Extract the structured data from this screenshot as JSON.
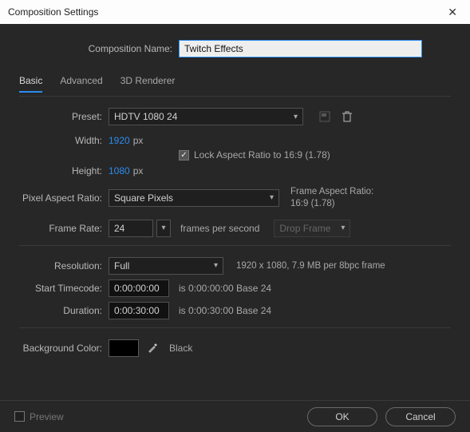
{
  "title": "Composition Settings",
  "header": {
    "comp_name_label": "Composition Name:",
    "comp_name_value": "Twitch Effects"
  },
  "tabs": {
    "basic": "Basic",
    "advanced": "Advanced",
    "renderer": "3D Renderer"
  },
  "preset": {
    "label": "Preset:",
    "value": "HDTV 1080 24"
  },
  "dimensions": {
    "width_label": "Width:",
    "width_value": "1920",
    "height_label": "Height:",
    "height_value": "1080",
    "px_unit": "px",
    "lock_label": "Lock Aspect Ratio to 16:9 (1.78)"
  },
  "par": {
    "label": "Pixel Aspect Ratio:",
    "value": "Square Pixels",
    "frame_aspect_label": "Frame Aspect Ratio:",
    "frame_aspect_value": "16:9 (1.78)"
  },
  "frame_rate": {
    "label": "Frame Rate:",
    "value": "24",
    "unit": "frames per second",
    "drop": "Drop Frame"
  },
  "resolution": {
    "label": "Resolution:",
    "value": "Full",
    "info": "1920 x 1080, 7.9 MB per 8bpc frame"
  },
  "timecode": {
    "start_label": "Start Timecode:",
    "start_value": "0:00:00:00",
    "start_info": "is 0:00:00:00  Base 24",
    "duration_label": "Duration:",
    "duration_value": "0:00:30:00",
    "duration_info": "is 0:00:30:00  Base 24"
  },
  "bg": {
    "label": "Background Color:",
    "name": "Black"
  },
  "footer": {
    "preview": "Preview",
    "ok": "OK",
    "cancel": "Cancel"
  }
}
